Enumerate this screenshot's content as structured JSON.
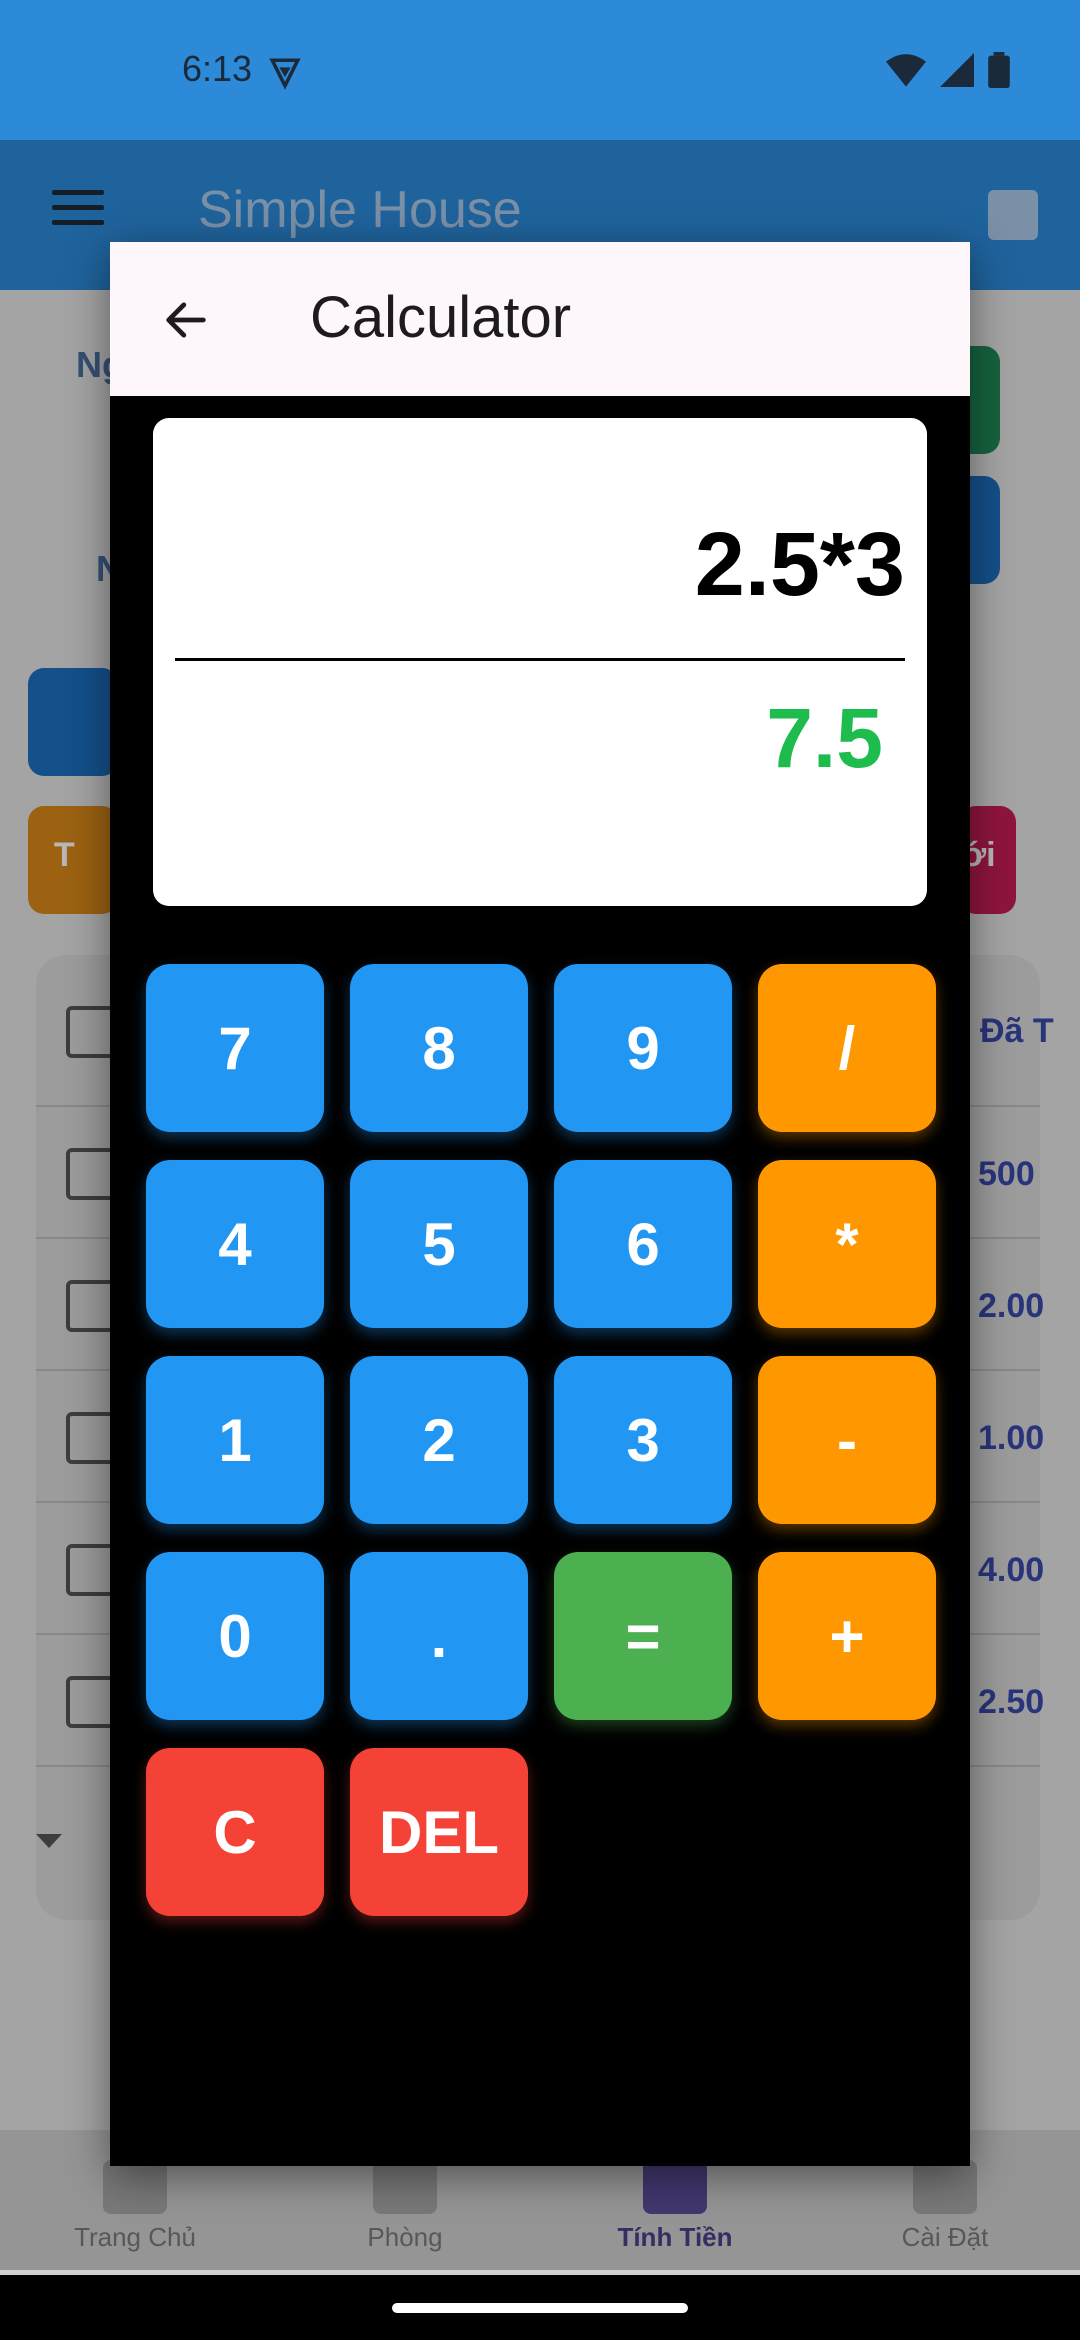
{
  "status_bar": {
    "time": "6:13"
  },
  "app": {
    "title": "Simple House",
    "background_labels": [
      "Ng",
      "N"
    ],
    "background_values": [
      "500",
      "2.00",
      "1.00",
      "4.00",
      "2.50"
    ],
    "background_header": "Đã T",
    "background_button_fragments": [
      "T",
      "ới"
    ]
  },
  "bottom_nav": {
    "items": [
      {
        "label": "Trang Chủ",
        "icon": "home-icon"
      },
      {
        "label": "Phòng",
        "icon": "door-icon"
      },
      {
        "label": "Tính Tiền",
        "icon": "calculator-icon",
        "active": true
      },
      {
        "label": "Cài Đặt",
        "icon": "person-icon"
      }
    ]
  },
  "dialog": {
    "title": "Calculator",
    "expression": "2.5*3",
    "result": "7.5",
    "keys": {
      "k7": "7",
      "k8": "8",
      "k9": "9",
      "div": "/",
      "k4": "4",
      "k5": "5",
      "k6": "6",
      "mul": "*",
      "k1": "1",
      "k2": "2",
      "k3": "3",
      "sub": "-",
      "k0": "0",
      "dot": ".",
      "eq": "=",
      "add": "+",
      "clear": "C",
      "del": "DEL"
    }
  },
  "colors": {
    "number_key": "#2196f3",
    "operator_key": "#ff9800",
    "equals_key": "#4caf50",
    "clear_key": "#f44336",
    "result_text": "#1ebb4d",
    "app_bar": "#2c8ad8"
  }
}
